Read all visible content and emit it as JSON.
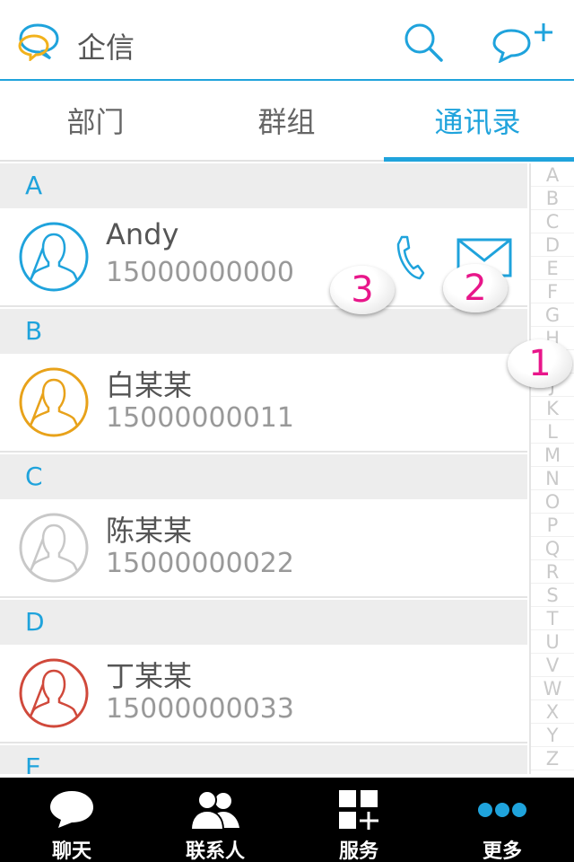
{
  "header": {
    "title": "企信"
  },
  "tabs": [
    {
      "label": "部门"
    },
    {
      "label": "群组"
    },
    {
      "label": "通讯录",
      "active": true
    }
  ],
  "contacts": [
    {
      "section": "A",
      "name": "Andy",
      "phone": "15000000000",
      "avatar_color": "#1fa3dc"
    },
    {
      "section": "B",
      "name": "白某某",
      "phone": "15000000011",
      "avatar_color": "#e8a21a"
    },
    {
      "section": "C",
      "name": "陈某某",
      "phone": "15000000022",
      "avatar_color": "#c8c8c8"
    },
    {
      "section": "D",
      "name": "丁某某",
      "phone": "15000000033",
      "avatar_color": "#d0493b"
    },
    {
      "section": "E"
    }
  ],
  "index_letters": [
    "A",
    "B",
    "C",
    "D",
    "E",
    "F",
    "G",
    "H",
    "I",
    "J",
    "K",
    "L",
    "M",
    "N",
    "O",
    "P",
    "Q",
    "R",
    "S",
    "T",
    "U",
    "V",
    "W",
    "X",
    "Y",
    "Z"
  ],
  "badges": [
    "1",
    "2",
    "3"
  ],
  "bottom_nav": [
    {
      "label": "聊天",
      "icon": "chat-bubble-icon"
    },
    {
      "label": "联系人",
      "icon": "contacts-icon"
    },
    {
      "label": "服务",
      "icon": "services-grid-icon"
    },
    {
      "label": "更多",
      "icon": "more-dots-icon"
    }
  ],
  "colors": {
    "accent": "#1fa3dc",
    "badge_text": "#e8168a",
    "nav_bg": "#000000"
  }
}
